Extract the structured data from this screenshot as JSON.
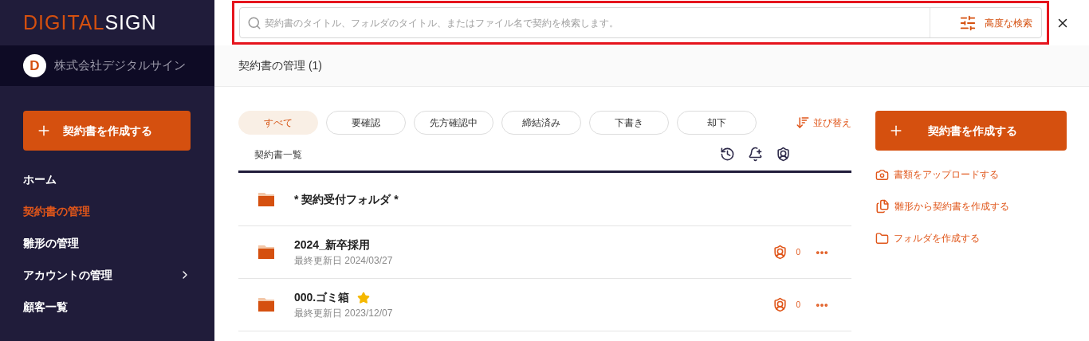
{
  "logo": {
    "left": "DIGITAL",
    "right": "SIGN"
  },
  "company": {
    "initial": "D",
    "name": "株式会社デジタルサイン"
  },
  "sidebar": {
    "create_button": "契約書を作成する",
    "items": [
      {
        "label": "ホーム",
        "selected": false,
        "has_submenu": false
      },
      {
        "label": "契約書の管理",
        "selected": true,
        "has_submenu": false
      },
      {
        "label": "雛形の管理",
        "selected": false,
        "has_submenu": false
      },
      {
        "label": "アカウントの管理",
        "selected": false,
        "has_submenu": true
      },
      {
        "label": "顧客一覧",
        "selected": false,
        "has_submenu": false
      }
    ]
  },
  "search": {
    "placeholder": "契約書のタイトル、フォルダのタイトル、またはファイル名で契約を検索します。",
    "advanced": "高度な検索",
    "highlighted": true
  },
  "breadcrumb": "契約書の管理 (1)",
  "filters": [
    {
      "label": "すべて",
      "selected": true
    },
    {
      "label": "要確認",
      "selected": false
    },
    {
      "label": "先方確認中",
      "selected": false
    },
    {
      "label": "締結済み",
      "selected": false
    },
    {
      "label": "下書き",
      "selected": false
    },
    {
      "label": "却下",
      "selected": false
    }
  ],
  "sort": "並び替え",
  "list_title": "契約書一覧",
  "rows": [
    {
      "name": "* 契約受付フォルダ *",
      "starred": false
    },
    {
      "name": "2024_新卒採用",
      "updated": "最終更新日 2024/03/27",
      "shield_count": "0",
      "starred": false
    },
    {
      "name": "000.ゴミ箱",
      "updated": "最終更新日 2023/12/07",
      "shield_count": "0",
      "starred": true
    }
  ],
  "actions": {
    "create_button": "契約書を作成する",
    "links": [
      {
        "kind": "upload",
        "label": "書類をアップロードする"
      },
      {
        "kind": "template",
        "label": "雛形から契約書を作成する"
      },
      {
        "kind": "folder",
        "label": "フォルダを作成する"
      }
    ]
  }
}
